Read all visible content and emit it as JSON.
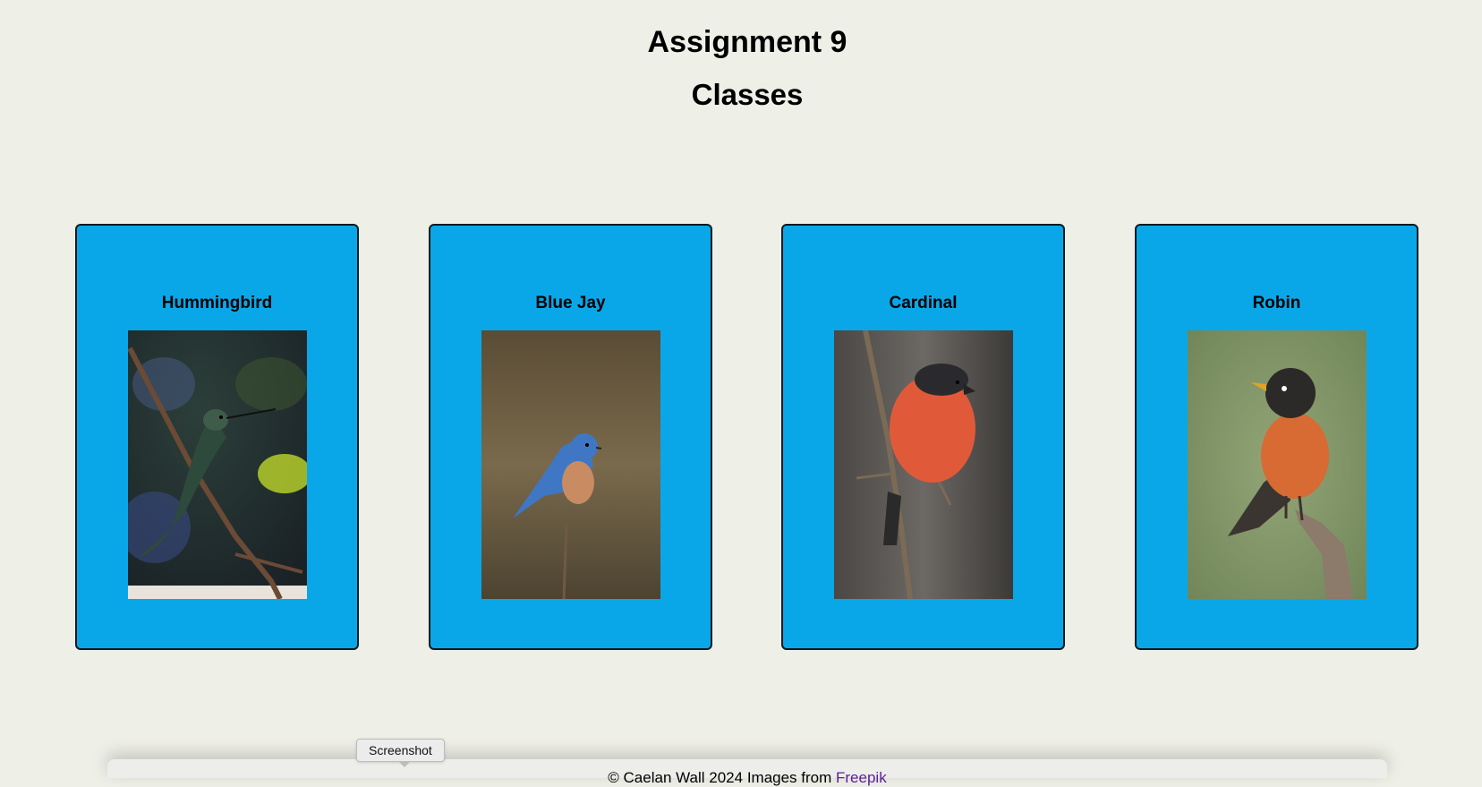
{
  "page": {
    "title": "Assignment 9",
    "subtitle": "Classes"
  },
  "cards": [
    {
      "name": "Hummingbird",
      "image_icon": "hummingbird-photo"
    },
    {
      "name": "Blue Jay",
      "image_icon": "blue-jay-photo"
    },
    {
      "name": "Cardinal",
      "image_icon": "cardinal-photo"
    },
    {
      "name": "Robin",
      "image_icon": "robin-photo"
    }
  ],
  "footer": {
    "text": "© Caelan Wall 2024 Images from ",
    "link": "Freepik"
  },
  "tooltip": {
    "label": "Screenshot"
  },
  "colors": {
    "background": "#eeefe6",
    "card": "#0aa7e8",
    "card_border": "#0b1a20",
    "link": "#5b1e9a"
  }
}
